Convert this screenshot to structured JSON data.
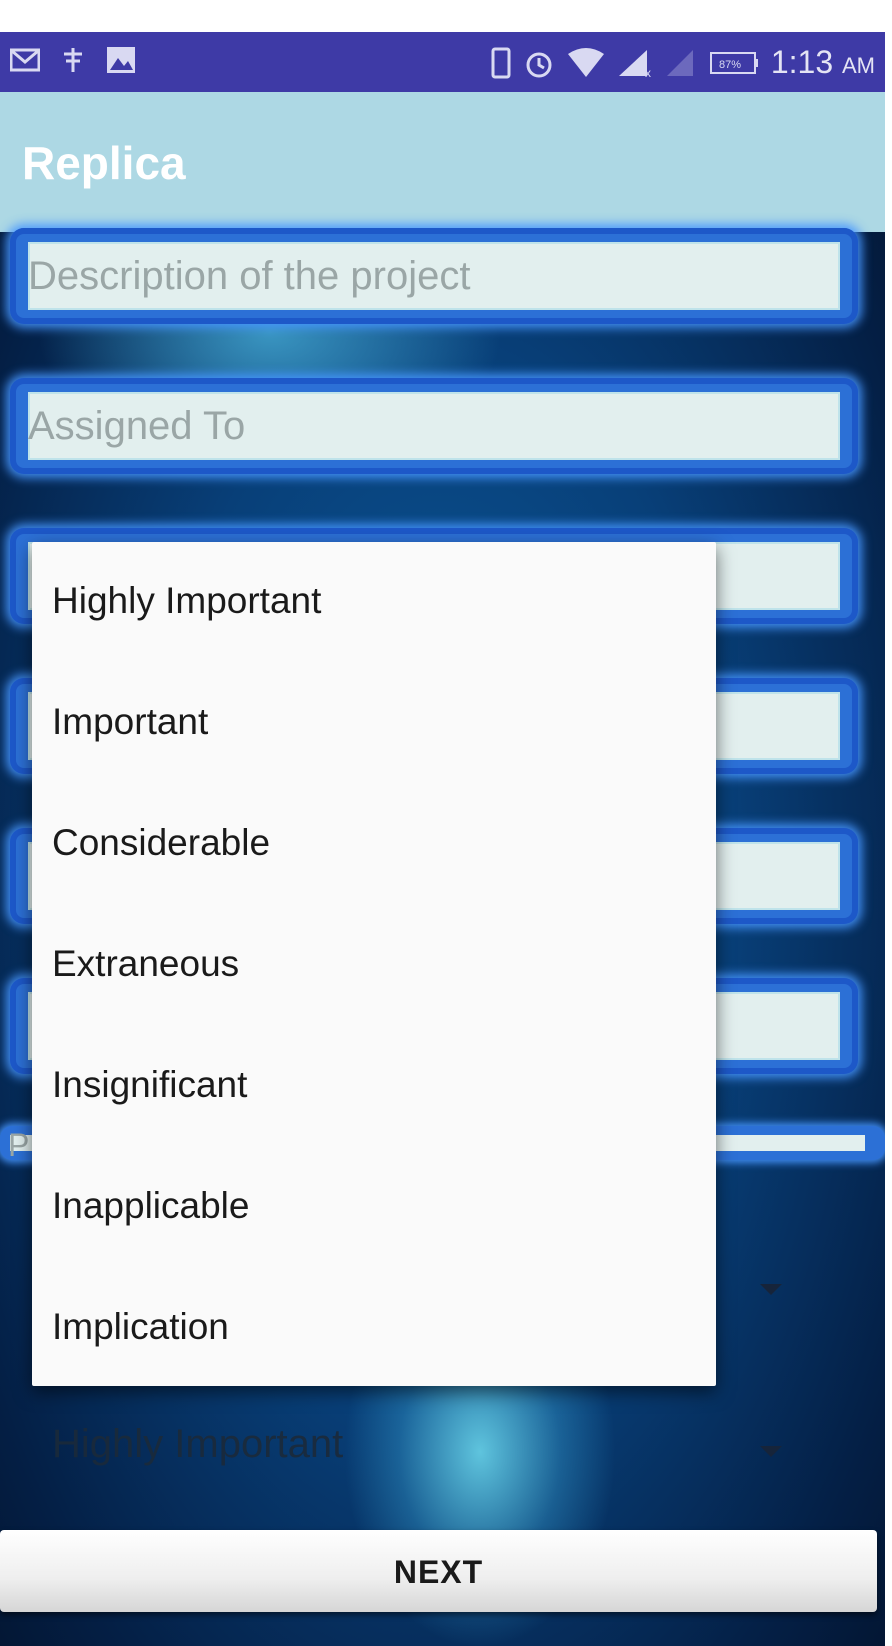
{
  "status_bar": {
    "time": "1:13",
    "time_suffix": "AM",
    "battery_text": "87%",
    "left_icons": [
      "mail-icon",
      "download-icon",
      "image-icon"
    ],
    "right_icons": [
      "phone-icon",
      "alarm-icon",
      "wifi-icon",
      "signal-icon",
      "signal-off-icon",
      "battery-icon"
    ]
  },
  "app_bar": {
    "title": "Replica"
  },
  "form": {
    "description_placeholder": "Description of the project",
    "assigned_to_placeholder": "Assigned To",
    "partial_field_placeholder": "P",
    "spinner_bottom_value": "Highly Important"
  },
  "dropdown": {
    "options": [
      "Highly Important",
      "Important",
      "Considerable",
      "Extraneous",
      "Insignificant",
      "Inapplicable",
      "Implication"
    ]
  },
  "next_button": {
    "label": "NEXT"
  },
  "colors": {
    "status_bar": "#3e3aa6",
    "app_bar": "#add8e4",
    "field_border": "#2c70d6",
    "field_fill": "#e2efee"
  }
}
